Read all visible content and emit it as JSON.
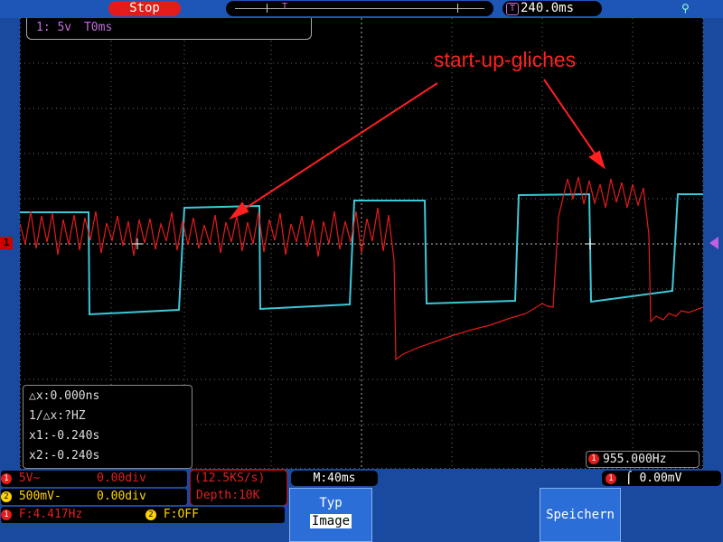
{
  "status": {
    "run_state": "Stop"
  },
  "horizontal": {
    "trigger_position": "240.0ms",
    "timebase": "M:40ms"
  },
  "channel_info": {
    "text": "1: 5v",
    "time_offset": "0ms"
  },
  "annotation": {
    "label": "start-up-gliches",
    "color": "#ff2020"
  },
  "cursors": {
    "dx": "△x:0.000ns",
    "inv_dx": "1/△x:?HZ",
    "x1": "x1:-0.240s",
    "x2": "x2:-0.240s"
  },
  "frequency_counter": {
    "channel": "1",
    "value": "955.000Hz"
  },
  "channels": [
    {
      "id": "1",
      "scale": "5V~",
      "offset": "0.00div",
      "color": "#e41b1b"
    },
    {
      "id": "2",
      "scale": "500mV-",
      "offset": "0.00div",
      "color": "#ffd400"
    }
  ],
  "measurements": {
    "ch1_freq": "F:4.417Hz",
    "ch2_freq": "F:OFF"
  },
  "acquisition": {
    "sample_rate": "(12.5KS/s)",
    "depth": "Depth:10K"
  },
  "trigger": {
    "channel": "1",
    "level": "0.00mV"
  },
  "softkeys": {
    "typ_label": "Typ",
    "typ_value": "Image",
    "save_label": "Speichern"
  },
  "colors": {
    "ch1_trace": "#e41b1b",
    "ch2_trace": "#3cc8d8",
    "ui_blue": "#1a4aa0",
    "math_purple": "#c070d8"
  },
  "icons": {
    "usb": "usb-icon",
    "trigger_marker": "trigger-t-icon"
  }
}
